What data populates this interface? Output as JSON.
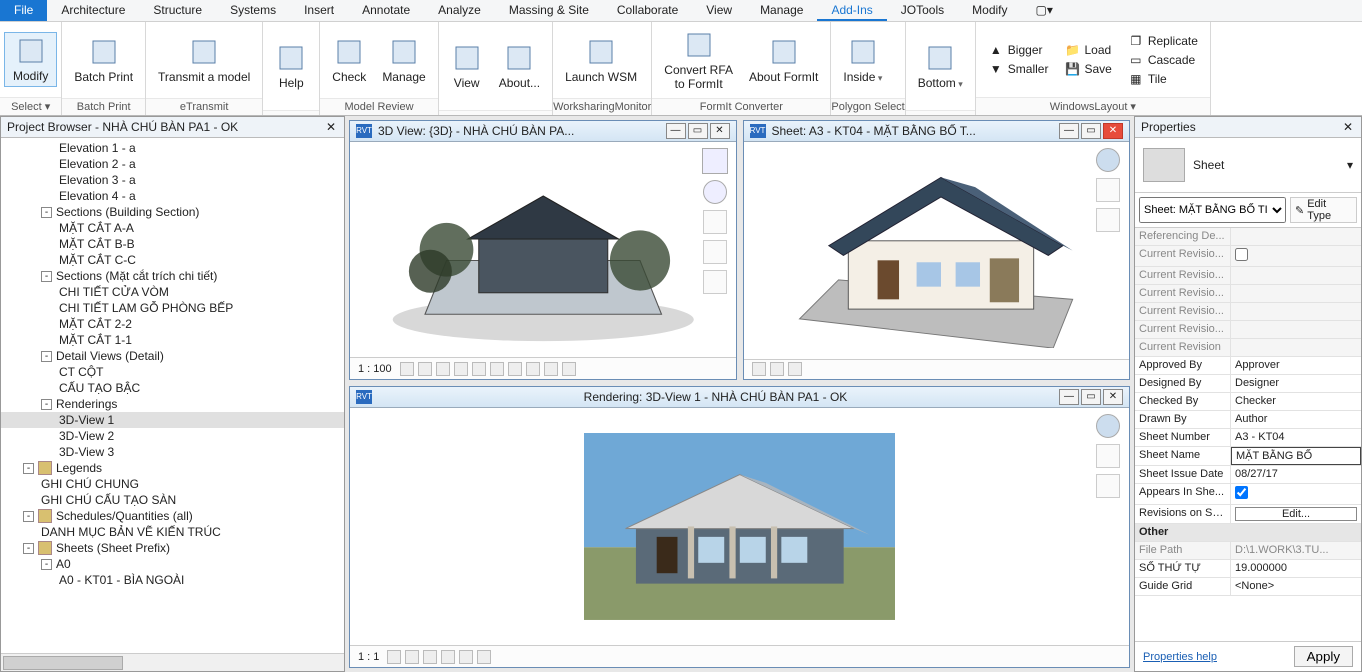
{
  "menu": [
    "File",
    "Architecture",
    "Structure",
    "Systems",
    "Insert",
    "Annotate",
    "Analyze",
    "Massing & Site",
    "Collaborate",
    "View",
    "Manage",
    "Add-Ins",
    "JOTools",
    "Modify"
  ],
  "menu_active": "Add-Ins",
  "ribbon": {
    "groups": [
      {
        "title": "Select ▾",
        "buttons": [
          {
            "label": "Modify",
            "big": true,
            "modify": true
          }
        ]
      },
      {
        "title": "Batch Print",
        "buttons": [
          {
            "label": "Batch Print",
            "big": true
          }
        ]
      },
      {
        "title": "eTransmit",
        "buttons": [
          {
            "label": "Transmit a model",
            "big": true
          }
        ]
      },
      {
        "title": "",
        "buttons": [
          {
            "label": "Help",
            "big": true
          }
        ]
      },
      {
        "title": "Model Review",
        "buttons": [
          {
            "label": "Check",
            "big": true
          },
          {
            "label": "Manage",
            "big": true
          }
        ]
      },
      {
        "title": "",
        "buttons": [
          {
            "label": "View",
            "top": true
          },
          {
            "label": "About...",
            "big": true
          }
        ]
      },
      {
        "title": "WorksharingMonitor",
        "buttons": [
          {
            "label": "Launch WSM",
            "big": true
          }
        ]
      },
      {
        "title": "FormIt Converter",
        "buttons": [
          {
            "label": "Convert RFA\nto FormIt",
            "big": true
          },
          {
            "label": "About FormIt",
            "big": true
          }
        ]
      },
      {
        "title": "Polygon Select",
        "buttons": [
          {
            "label": "Inside",
            "big": true,
            "dd": true
          }
        ]
      },
      {
        "title": "",
        "buttons": [
          {
            "label": "Bottom",
            "big": true,
            "dd": true
          }
        ]
      },
      {
        "title": "WindowsLayout ▾",
        "small": [
          [
            {
              "label": "Bigger",
              "ic": "▲"
            },
            {
              "label": "Smaller",
              "ic": "▼"
            }
          ],
          [
            {
              "label": "Load",
              "ic": "📁"
            },
            {
              "label": "Save",
              "ic": "💾"
            }
          ],
          [
            {
              "label": "Replicate",
              "ic": "❐"
            },
            {
              "label": "Cascade",
              "ic": "▭"
            },
            {
              "label": "Tile",
              "ic": "▦"
            }
          ]
        ]
      }
    ]
  },
  "pb": {
    "title": "Project Browser - NHÀ CHÚ BÀN PA1 - OK",
    "rows": [
      {
        "ind": 3,
        "label": "Elevation 1 - a"
      },
      {
        "ind": 3,
        "label": "Elevation 2 - a"
      },
      {
        "ind": 3,
        "label": "Elevation 3 - a"
      },
      {
        "ind": 3,
        "label": "Elevation 4 - a"
      },
      {
        "ind": 2,
        "exp": "-",
        "label": "Sections (Building Section)"
      },
      {
        "ind": 3,
        "label": "MẶT CẮT A-A"
      },
      {
        "ind": 3,
        "label": "MẶT CẮT B-B"
      },
      {
        "ind": 3,
        "label": "MẶT CẮT C-C"
      },
      {
        "ind": 2,
        "exp": "-",
        "label": "Sections (Mặt cắt trích chi tiết)"
      },
      {
        "ind": 3,
        "label": "CHI TIẾT CỬA VÒM"
      },
      {
        "ind": 3,
        "label": "CHI TIẾT LAM GỖ PHÒNG BẾP"
      },
      {
        "ind": 3,
        "label": "MẶT CẮT 2-2"
      },
      {
        "ind": 3,
        "label": "MẶT CẮT 1-1"
      },
      {
        "ind": 2,
        "exp": "-",
        "label": "Detail Views (Detail)"
      },
      {
        "ind": 3,
        "label": "CT CỘT"
      },
      {
        "ind": 3,
        "label": "CẤU TẠO BẬC"
      },
      {
        "ind": 2,
        "exp": "-",
        "label": "Renderings"
      },
      {
        "ind": 3,
        "label": "3D-View 1",
        "sel": true
      },
      {
        "ind": 3,
        "label": "3D-View 2"
      },
      {
        "ind": 3,
        "label": "3D-View 3"
      },
      {
        "ind": 1,
        "exp": "-",
        "ic": "leg",
        "label": "Legends"
      },
      {
        "ind": 2,
        "label": "GHI CHÚ CHUNG"
      },
      {
        "ind": 2,
        "label": "GHI CHÚ CẤU TẠO SÀN"
      },
      {
        "ind": 1,
        "exp": "-",
        "ic": "sch",
        "label": "Schedules/Quantities (all)"
      },
      {
        "ind": 2,
        "label": "DANH MỤC BẢN VẼ KIẾN TRÚC"
      },
      {
        "ind": 1,
        "exp": "-",
        "ic": "sht",
        "label": "Sheets (Sheet Prefix)"
      },
      {
        "ind": 2,
        "exp": "-",
        "label": "A0"
      },
      {
        "ind": 3,
        "label": "A0 - KT01 - BÌA NGOÀI"
      }
    ]
  },
  "vp": [
    {
      "title": "3D View: {3D} - NHÀ CHÚ BÀN PA...",
      "scale": "1 : 100",
      "close": false
    },
    {
      "title": "Sheet: A3 - KT04 - MẶT BẰNG BỐ T...",
      "scale": "",
      "close": true
    },
    {
      "title": "Rendering: 3D-View 1 - NHÀ CHÚ BÀN PA1 - OK",
      "scale": "1 : 1",
      "close": false
    }
  ],
  "props": {
    "title": "Properties",
    "type": "Sheet",
    "selector": "Sheet: MẶT BẰNG BỐ TI",
    "edit_type": "Edit Type",
    "rows": [
      {
        "k": "Referencing De...",
        "v": "",
        "ro": true
      },
      {
        "k": "Current Revisio...",
        "v": "",
        "ro": true,
        "cb": false
      },
      {
        "k": "Current Revisio...",
        "v": "",
        "ro": true
      },
      {
        "k": "Current Revisio...",
        "v": "",
        "ro": true
      },
      {
        "k": "Current Revisio...",
        "v": "",
        "ro": true
      },
      {
        "k": "Current Revisio...",
        "v": "",
        "ro": true
      },
      {
        "k": "Current Revision",
        "v": "",
        "ro": true
      },
      {
        "k": "Approved By",
        "v": "Approver"
      },
      {
        "k": "Designed By",
        "v": "Designer"
      },
      {
        "k": "Checked By",
        "v": "Checker"
      },
      {
        "k": "Drawn By",
        "v": "Author"
      },
      {
        "k": "Sheet Number",
        "v": "A3 - KT04"
      },
      {
        "k": "Sheet Name",
        "v": "MẶT BẰNG BỐ",
        "box": true
      },
      {
        "k": "Sheet Issue Date",
        "v": "08/27/17"
      },
      {
        "k": "Appears In She...",
        "v": "",
        "cb": true
      },
      {
        "k": "Revisions on Sh...",
        "v": "Edit...",
        "btn": true
      },
      {
        "section": "Other"
      },
      {
        "k": "File Path",
        "v": "D:\\1.WORK\\3.TU...",
        "ro": true
      },
      {
        "k": "SỐ THỨ TỰ",
        "v": "19.000000"
      },
      {
        "k": "Guide Grid",
        "v": "<None>"
      }
    ],
    "help": "Properties help",
    "apply": "Apply"
  }
}
